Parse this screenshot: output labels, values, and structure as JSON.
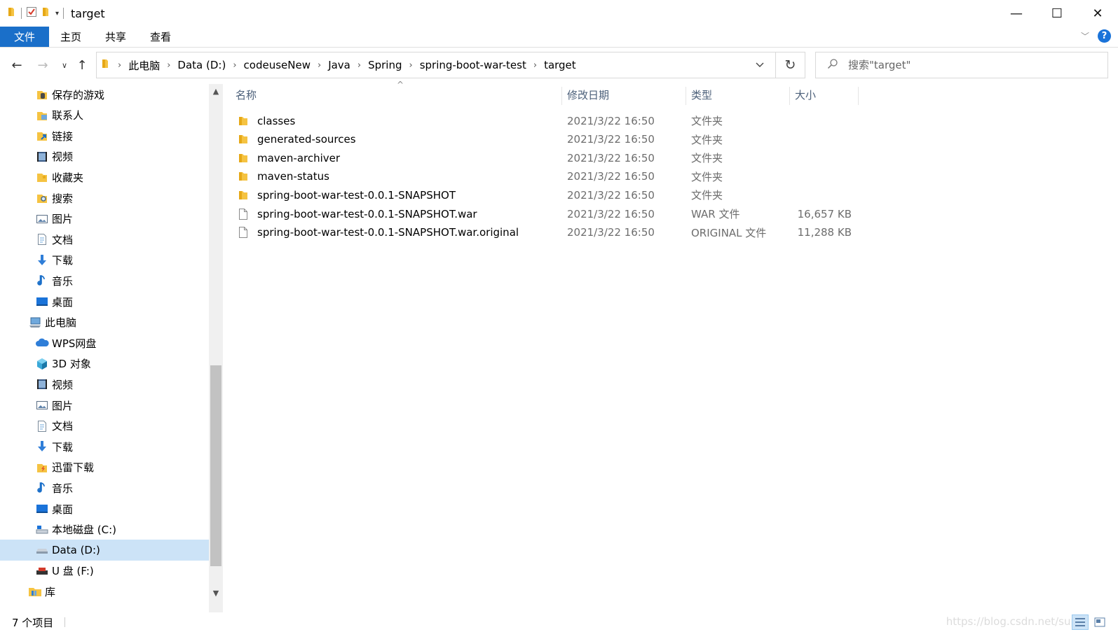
{
  "window": {
    "title": "target",
    "minimize": "—",
    "maximize": "☐",
    "close": "✕"
  },
  "ribbon": {
    "tabs": [
      {
        "label": "文件",
        "active": true
      },
      {
        "label": "主页"
      },
      {
        "label": "共享"
      },
      {
        "label": "查看"
      }
    ],
    "help": "?"
  },
  "address": {
    "crumbs": [
      "此电脑",
      "Data (D:)",
      "codeuseNew",
      "Java",
      "Spring",
      "spring-boot-war-test",
      "target"
    ],
    "search_placeholder": "搜索\"target\""
  },
  "nav": {
    "items": [
      {
        "label": "保存的游戏",
        "icon": "saved-games-icon"
      },
      {
        "label": "联系人",
        "icon": "contacts-icon"
      },
      {
        "label": "链接",
        "icon": "links-icon"
      },
      {
        "label": "视频",
        "icon": "video-icon"
      },
      {
        "label": "收藏夹",
        "icon": "favorites-icon"
      },
      {
        "label": "搜索",
        "icon": "searches-icon"
      },
      {
        "label": "图片",
        "icon": "pictures-icon"
      },
      {
        "label": "文档",
        "icon": "documents-icon"
      },
      {
        "label": "下载",
        "icon": "downloads-icon"
      },
      {
        "label": "音乐",
        "icon": "music-icon"
      },
      {
        "label": "桌面",
        "icon": "desktop-icon"
      },
      {
        "label": "此电脑",
        "icon": "this-pc-icon",
        "level": 0
      },
      {
        "label": "WPS网盘",
        "icon": "cloud-icon"
      },
      {
        "label": "3D 对象",
        "icon": "3d-objects-icon"
      },
      {
        "label": "视频",
        "icon": "video-icon"
      },
      {
        "label": "图片",
        "icon": "pictures-icon"
      },
      {
        "label": "文档",
        "icon": "documents-icon"
      },
      {
        "label": "下载",
        "icon": "downloads-icon"
      },
      {
        "label": "迅雷下载",
        "icon": "thunder-download-icon"
      },
      {
        "label": "音乐",
        "icon": "music-icon"
      },
      {
        "label": "桌面",
        "icon": "desktop-icon"
      },
      {
        "label": "本地磁盘 (C:)",
        "icon": "local-disk-icon"
      },
      {
        "label": "Data (D:)",
        "icon": "drive-icon",
        "selected": true
      },
      {
        "label": "U 盘 (F:)",
        "icon": "usb-drive-icon"
      },
      {
        "label": "库",
        "icon": "library-icon",
        "level": 0
      }
    ]
  },
  "files": {
    "columns": [
      "名称",
      "修改日期",
      "类型",
      "大小"
    ],
    "rows": [
      {
        "name": "classes",
        "date": "2021/3/22 16:50",
        "type": "文件夹",
        "size": "",
        "kind": "folder"
      },
      {
        "name": "generated-sources",
        "date": "2021/3/22 16:50",
        "type": "文件夹",
        "size": "",
        "kind": "folder"
      },
      {
        "name": "maven-archiver",
        "date": "2021/3/22 16:50",
        "type": "文件夹",
        "size": "",
        "kind": "folder"
      },
      {
        "name": "maven-status",
        "date": "2021/3/22 16:50",
        "type": "文件夹",
        "size": "",
        "kind": "folder"
      },
      {
        "name": "spring-boot-war-test-0.0.1-SNAPSHOT",
        "date": "2021/3/22 16:50",
        "type": "文件夹",
        "size": "",
        "kind": "folder"
      },
      {
        "name": "spring-boot-war-test-0.0.1-SNAPSHOT.war",
        "date": "2021/3/22 16:50",
        "type": "WAR 文件",
        "size": "16,657 KB",
        "kind": "file"
      },
      {
        "name": "spring-boot-war-test-0.0.1-SNAPSHOT.war.original",
        "date": "2021/3/22 16:50",
        "type": "ORIGINAL 文件",
        "size": "11,288 KB",
        "kind": "file"
      }
    ]
  },
  "status": {
    "item_count": "7 个项目",
    "watermark": "https://blog.csdn.net/sup"
  },
  "colors": {
    "accent": "#1a6fc9",
    "selection": "#cce3f7",
    "folder": "#f5c342"
  }
}
